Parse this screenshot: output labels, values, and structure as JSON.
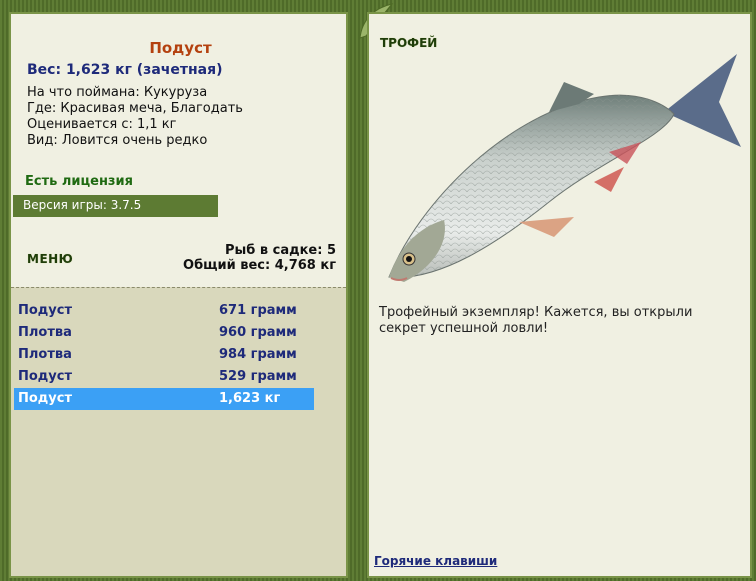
{
  "left": {
    "catch_title": "Подуст",
    "weight_line": "Вес: 1,623 кг (зачетная)",
    "info": [
      "На что поймана: Кукуруза",
      "Где: Красивая меча, Благодать",
      "Оценивается с: 1,1 кг",
      "Вид: Ловится очень редко"
    ],
    "license": "Есть лицензия",
    "version": "Версия игры: 3.7.5",
    "menu_label": "МЕНЮ",
    "keep_count": "Рыб в садке: 5",
    "total_weight": "Общий вес: 4,768 кг"
  },
  "catches": [
    {
      "name": "Подуст",
      "weight": "671 грамм"
    },
    {
      "name": "Плотва",
      "weight": "960 грамм"
    },
    {
      "name": "Плотва",
      "weight": "984 грамм"
    },
    {
      "name": "Подуст",
      "weight": "529 грамм"
    },
    {
      "name": "Подуст",
      "weight": "1,623 кг"
    }
  ],
  "selected_catch_index": 4,
  "right": {
    "trophy_label": "ТРОФЕЙ",
    "trophy_text": "Трофейный экземпляр! Кажется, вы открыли секрет успешной ловли!",
    "hotkeys": "Горячие клавиши"
  },
  "colors": {
    "frame_green": "#5f7d35",
    "panel_bg": "#f0f0e2",
    "list_bg": "#d9d8bc",
    "selection_blue": "#3ba0f5",
    "title_orange": "#b4410f",
    "text_navy": "#1e2a7a",
    "license_green": "#1f6a12"
  },
  "icons": [
    "leaf-decoration-icon",
    "fish-trophy-image"
  ]
}
